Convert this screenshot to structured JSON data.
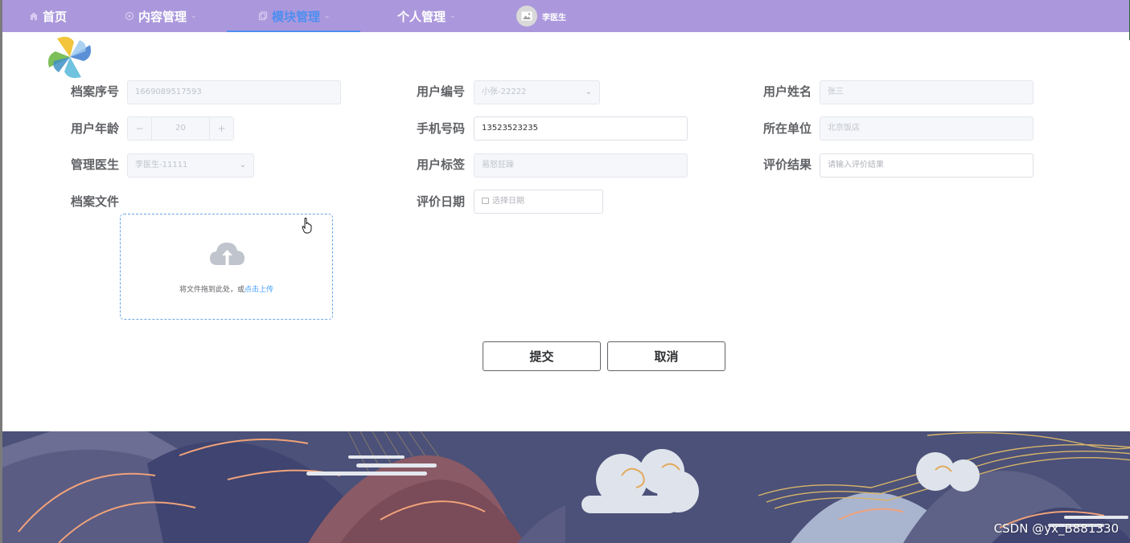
{
  "nav": {
    "items": [
      {
        "label": "首页",
        "icon": "home-icon"
      },
      {
        "label": "内容管理",
        "icon": "content-icon"
      },
      {
        "label": "模块管理",
        "icon": "module-icon"
      },
      {
        "label": "个人管理",
        "icon": ""
      }
    ],
    "active_index": 2,
    "user_name": "李医生",
    "background_color": "#ab98dc",
    "active_color": "#4e8ef0"
  },
  "form": {
    "archive_no": {
      "label": "档案序号",
      "value": "1669089517593"
    },
    "user_code": {
      "label": "用户编号",
      "value": "小张-22222"
    },
    "user_name": {
      "label": "用户姓名",
      "value": "张三"
    },
    "user_age": {
      "label": "用户年龄",
      "value": "20",
      "minus": "−",
      "plus": "+"
    },
    "phone": {
      "label": "手机号码",
      "value": "13523523235"
    },
    "unit": {
      "label": "所在单位",
      "value": "北京饭店"
    },
    "doctor": {
      "label": "管理医生",
      "value": "李医生-11111"
    },
    "user_tag": {
      "label": "用户标签",
      "value": "易怒狂躁"
    },
    "eval_result": {
      "label": "评价结果",
      "placeholder": "请输入评价结果"
    },
    "archive_file": {
      "label": "档案文件"
    },
    "eval_date": {
      "label": "评价日期",
      "placeholder": "选择日期"
    }
  },
  "upload": {
    "text": "将文件拖到此处，或",
    "link": "点击上传",
    "border_color": "#6aa5e6"
  },
  "actions": {
    "submit": "提交",
    "cancel": "取消"
  },
  "watermark": "CSDN @yx_B881330"
}
